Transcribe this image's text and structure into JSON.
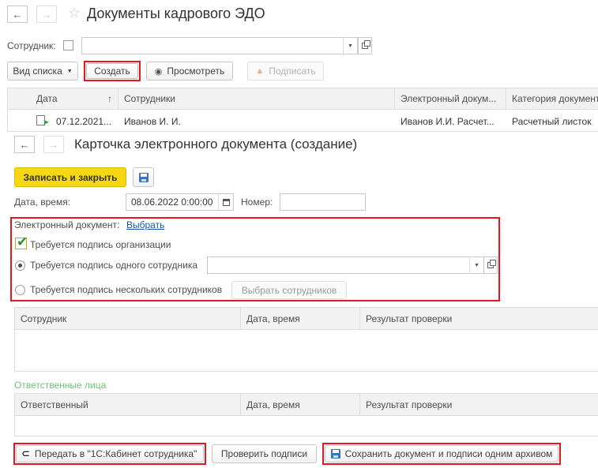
{
  "window": {
    "title": "Документы кадрового ЭДО"
  },
  "filter": {
    "employee_label": "Сотрудник:",
    "employee_value": ""
  },
  "toolbar": {
    "view_list": "Вид списка",
    "create": "Создать",
    "view": "Просмотреть",
    "sign": "Подписать"
  },
  "list": {
    "columns": [
      "Дата",
      "Сотрудники",
      "Электронный докум...",
      "Категория документ"
    ],
    "rows": [
      {
        "date": "07.12.2021...",
        "employees": "Иванов И. И.",
        "edoc": "Иванов И.И. Расчет...",
        "category": "Расчетный листок"
      }
    ]
  },
  "card": {
    "title": "Карточка электронного документа (создание)",
    "save_close": "Записать и закрыть",
    "datetime_label": "Дата, время:",
    "datetime_value": "08.06.2022  0:00:00",
    "number_label": "Номер:",
    "number_value": "",
    "edoc_label": "Электронный документ:",
    "edoc_link": "Выбрать",
    "org_sign_label": "Требуется подпись организации",
    "org_sign_checked": true,
    "one_employee_label": "Требуется подпись одного сотрудника",
    "one_employee_value": "",
    "many_employees_label": "Требуется подпись нескольких сотрудников",
    "select_employees": "Выбрать сотрудников",
    "signers_columns": [
      "Сотрудник",
      "Дата, время",
      "Результат проверки"
    ],
    "responsible_title": "Ответственные лица",
    "responsible_columns": [
      "Ответственный",
      "Дата, время",
      "Результат проверки"
    ],
    "send_button": "Передать в \"1С:Кабинет сотрудника\"",
    "check_button": "Проверить подписи",
    "save_archive_button": "Сохранить документ и подписи одним архивом"
  },
  "colors": {
    "accent_yellow": "#f5d714",
    "highlight_red": "#e8141e",
    "link_blue": "#1a56a8",
    "section_green": "#6fbf73"
  }
}
